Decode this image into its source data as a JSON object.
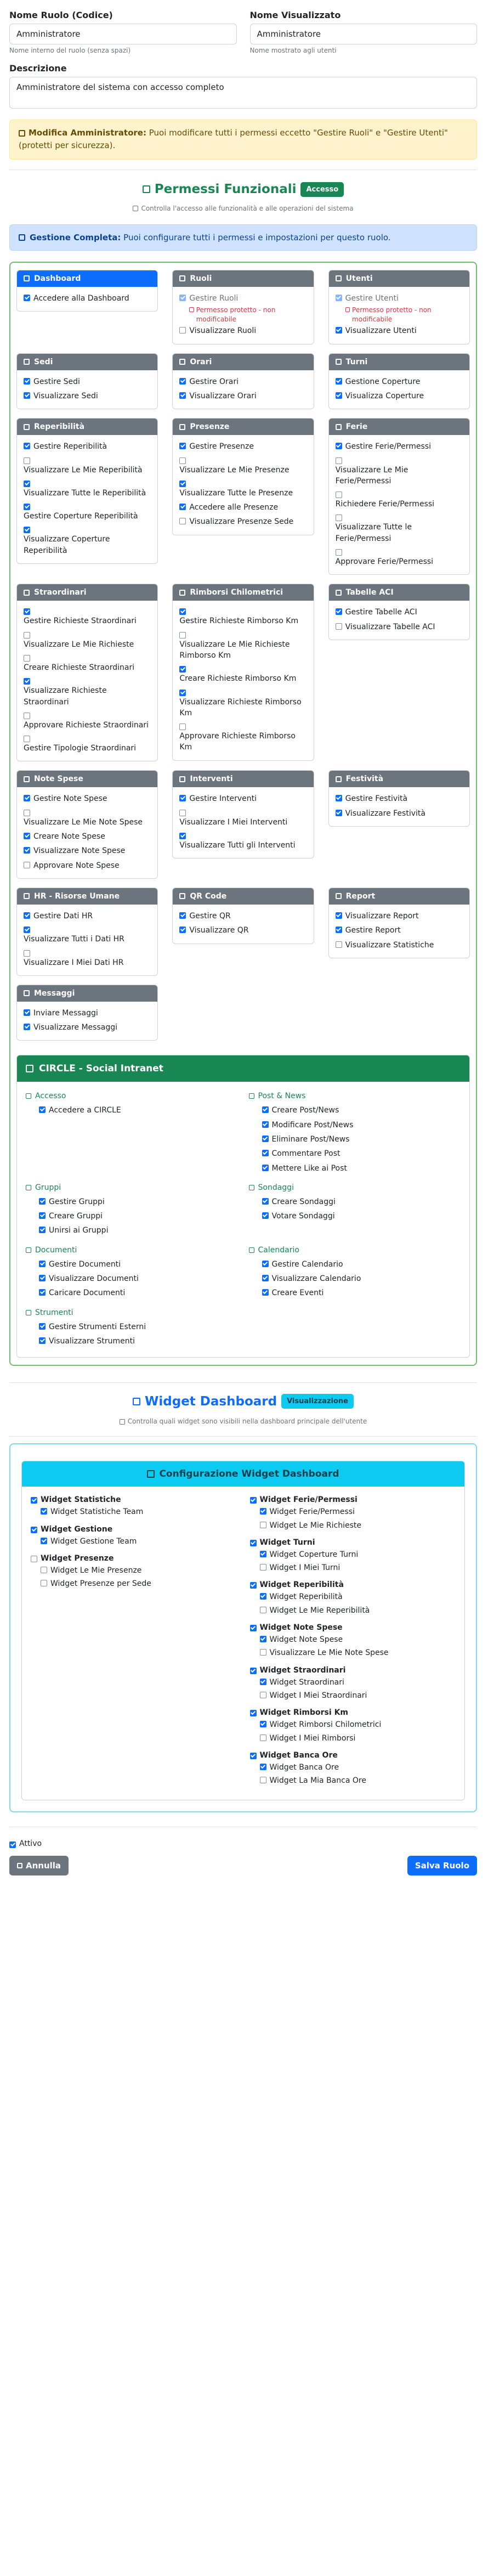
{
  "form": {
    "code_label": "Nome Ruolo (Codice)",
    "code_value": "Amministratore",
    "code_hint": "Nome interno del ruolo (senza spazi)",
    "display_label": "Nome Visualizzato",
    "display_value": "Amministratore",
    "display_hint": "Nome mostrato agli utenti",
    "desc_label": "Descrizione",
    "desc_value": "Amministratore del sistema con accesso completo"
  },
  "admin_alert": {
    "title": "Modifica Amministratore:",
    "text": " Puoi modificare tutti i permessi eccetto \"Gestire Ruoli\" e \"Gestire Utenti\" (protetti per sicurezza)."
  },
  "functional": {
    "title": "Permessi Funzionali",
    "badge": "Accesso",
    "subtitle": "Controlla l'accesso alle funzionalità e alle operazioni del sistema",
    "info_title": "Gestione Completa:",
    "info_text": " Puoi configurare tutti i permessi e impostazioni per questo ruolo.",
    "protected_note": "Permesso protetto - non modificabile",
    "cards": [
      {
        "title": "Dashboard",
        "primary": true,
        "items": [
          {
            "label": "Accedere alla Dashboard",
            "on": true
          }
        ]
      },
      {
        "title": "Ruoli",
        "items": [
          {
            "label": "Gestire Ruoli",
            "on": true,
            "protected": true
          },
          {
            "label": "Visualizzare Ruoli",
            "on": false
          }
        ]
      },
      {
        "title": "Utenti",
        "items": [
          {
            "label": "Gestire Utenti",
            "on": true,
            "protected": true
          },
          {
            "label": "Visualizzare Utenti",
            "on": true
          }
        ]
      },
      {
        "title": "Sedi",
        "items": [
          {
            "label": "Gestire Sedi",
            "on": true
          },
          {
            "label": "Visualizzare Sedi",
            "on": true
          }
        ]
      },
      {
        "title": "Orari",
        "items": [
          {
            "label": "Gestire Orari",
            "on": true
          },
          {
            "label": "Visualizzare Orari",
            "on": true
          }
        ]
      },
      {
        "title": "Turni",
        "items": [
          {
            "label": "Gestione Coperture",
            "on": true
          },
          {
            "label": "Visualizza Coperture",
            "on": true
          }
        ]
      },
      {
        "title": "Reperibilità",
        "stack": true,
        "items": [
          {
            "label": "Gestire Reperibilità",
            "on": true,
            "inline": true
          },
          {
            "label": "Visualizzare Le Mie Reperibilità",
            "on": false
          },
          {
            "label": "Visualizzare Tutte le Reperibilità",
            "on": true
          },
          {
            "label": "Gestire Coperture Reperibilità",
            "on": true
          },
          {
            "label": "Visualizzare Coperture Reperibilità",
            "on": true
          }
        ]
      },
      {
        "title": "Presenze",
        "stack": true,
        "items": [
          {
            "label": "Gestire Presenze",
            "on": true,
            "inline": true
          },
          {
            "label": "Visualizzare Le Mie Presenze",
            "on": false
          },
          {
            "label": "Visualizzare Tutte le Presenze",
            "on": true
          },
          {
            "label": "Accedere alle Presenze",
            "on": true,
            "inline": true
          },
          {
            "label": "Visualizzare Presenze Sede",
            "on": false,
            "inline": true
          }
        ]
      },
      {
        "title": "Ferie",
        "stack": true,
        "items": [
          {
            "label": "Gestire Ferie/Permessi",
            "on": true,
            "inline": true
          },
          {
            "label": "Visualizzare Le Mie Ferie/Permessi",
            "on": false
          },
          {
            "label": "Richiedere Ferie/Permessi",
            "on": false
          },
          {
            "label": "Visualizzare Tutte le Ferie/Permessi",
            "on": false
          },
          {
            "label": "Approvare Ferie/Permessi",
            "on": false
          }
        ]
      },
      {
        "title": "Straordinari",
        "stack": true,
        "items": [
          {
            "label": "Gestire Richieste Straordinari",
            "on": true
          },
          {
            "label": "Visualizzare Le Mie Richieste",
            "on": false
          },
          {
            "label": "Creare Richieste Straordinari",
            "on": false
          },
          {
            "label": "Visualizzare Richieste Straordinari",
            "on": true
          },
          {
            "label": "Approvare Richieste Straordinari",
            "on": false
          },
          {
            "label": "Gestire Tipologie Straordinari",
            "on": false
          }
        ]
      },
      {
        "title": "Rimborsi Chilometrici",
        "stack": true,
        "items": [
          {
            "label": "Gestire Richieste Rimborso Km",
            "on": true
          },
          {
            "label": "Visualizzare Le Mie Richieste Rimborso Km",
            "on": false
          },
          {
            "label": "Creare Richieste Rimborso Km",
            "on": true
          },
          {
            "label": "Visualizzare Richieste Rimborso Km",
            "on": true
          },
          {
            "label": "Approvare Richieste Rimborso Km",
            "on": false
          }
        ]
      },
      {
        "title": "Tabelle ACI",
        "items": [
          {
            "label": "Gestire Tabelle ACI",
            "on": true
          },
          {
            "label": "Visualizzare Tabelle ACI",
            "on": false
          }
        ]
      },
      {
        "title": "Note Spese",
        "stack": true,
        "items": [
          {
            "label": "Gestire Note Spese",
            "on": true,
            "inline": true
          },
          {
            "label": "Visualizzare Le Mie Note Spese",
            "on": false
          },
          {
            "label": "Creare Note Spese",
            "on": true,
            "inline": true
          },
          {
            "label": "Visualizzare Note Spese",
            "on": true,
            "inline": true
          },
          {
            "label": "Approvare Note Spese",
            "on": false,
            "inline": true
          }
        ]
      },
      {
        "title": "Interventi",
        "stack": true,
        "items": [
          {
            "label": "Gestire Interventi",
            "on": true,
            "inline": true
          },
          {
            "label": "Visualizzare I Miei Interventi",
            "on": false
          },
          {
            "label": "Visualizzare Tutti gli Interventi",
            "on": true
          }
        ]
      },
      {
        "title": "Festività",
        "items": [
          {
            "label": "Gestire Festività",
            "on": true
          },
          {
            "label": "Visualizzare Festività",
            "on": true
          }
        ]
      },
      {
        "title": "HR - Risorse Umane",
        "stack": true,
        "items": [
          {
            "label": "Gestire Dati HR",
            "on": true,
            "inline": true
          },
          {
            "label": "Visualizzare Tutti i Dati HR",
            "on": true
          },
          {
            "label": "Visualizzare I Miei Dati HR",
            "on": false
          }
        ]
      },
      {
        "title": "QR Code",
        "items": [
          {
            "label": "Gestire QR",
            "on": true
          },
          {
            "label": "Visualizzare QR",
            "on": true
          }
        ]
      },
      {
        "title": "Report",
        "items": [
          {
            "label": "Visualizzare Report",
            "on": true
          },
          {
            "label": "Gestire Report",
            "on": true
          },
          {
            "label": "Visualizzare Statistiche",
            "on": false
          }
        ]
      },
      {
        "title": "Messaggi",
        "items": [
          {
            "label": "Inviare Messaggi",
            "on": true
          },
          {
            "label": "Visualizzare Messaggi",
            "on": true
          }
        ]
      }
    ]
  },
  "circle": {
    "title": "CIRCLE - Social Intranet",
    "groups": [
      {
        "title": "Accesso",
        "items": [
          {
            "label": "Accedere a CIRCLE",
            "on": true
          }
        ]
      },
      {
        "title": "Post & News",
        "items": [
          {
            "label": "Creare Post/News",
            "on": true
          },
          {
            "label": "Modificare Post/News",
            "on": true
          },
          {
            "label": "Eliminare Post/News",
            "on": true
          },
          {
            "label": "Commentare Post",
            "on": true
          },
          {
            "label": "Mettere Like ai Post",
            "on": true
          }
        ]
      },
      {
        "title": "Gruppi",
        "items": [
          {
            "label": "Gestire Gruppi",
            "on": true
          },
          {
            "label": "Creare Gruppi",
            "on": true
          },
          {
            "label": "Unirsi ai Gruppi",
            "on": true
          }
        ]
      },
      {
        "title": "Sondaggi",
        "items": [
          {
            "label": "Creare Sondaggi",
            "on": true
          },
          {
            "label": "Votare Sondaggi",
            "on": true
          }
        ]
      },
      {
        "title": "Documenti",
        "items": [
          {
            "label": "Gestire Documenti",
            "on": true
          },
          {
            "label": "Visualizzare Documenti",
            "on": true
          },
          {
            "label": "Caricare Documenti",
            "on": true
          }
        ]
      },
      {
        "title": "Calendario",
        "items": [
          {
            "label": "Gestire Calendario",
            "on": true
          },
          {
            "label": "Visualizzare Calendario",
            "on": true
          },
          {
            "label": "Creare Eventi",
            "on": true
          }
        ]
      },
      {
        "title": "Strumenti",
        "items": [
          {
            "label": "Gestire Strumenti Esterni",
            "on": true
          },
          {
            "label": "Visualizzare Strumenti",
            "on": true
          }
        ]
      }
    ]
  },
  "widgets": {
    "title": "Widget Dashboard",
    "badge": "Visualizzazione",
    "subtitle": "Controlla quali widget sono visibili nella dashboard principale dell'utente",
    "card_title": "Configurazione Widget Dashboard",
    "left": [
      {
        "label": "Widget Statistiche",
        "on": true,
        "subs": [
          {
            "label": "Widget Statistiche Team",
            "on": true
          }
        ]
      },
      {
        "label": "Widget Gestione",
        "on": true,
        "subs": [
          {
            "label": "Widget Gestione Team",
            "on": true
          }
        ]
      },
      {
        "label": "Widget Presenze",
        "on": false,
        "subs": [
          {
            "label": "Widget Le Mie Presenze",
            "on": false
          },
          {
            "label": "Widget Presenze per Sede",
            "on": false
          }
        ]
      }
    ],
    "right": [
      {
        "label": "Widget Ferie/Permessi",
        "on": true,
        "subs": [
          {
            "label": "Widget Ferie/Permessi",
            "on": true
          },
          {
            "label": "Widget Le Mie Richieste",
            "on": false
          }
        ]
      },
      {
        "label": "Widget Turni",
        "on": true,
        "subs": [
          {
            "label": "Widget Coperture Turni",
            "on": true
          },
          {
            "label": "Widget I Miei Turni",
            "on": false
          }
        ]
      },
      {
        "label": "Widget Reperibilità",
        "on": true,
        "subs": [
          {
            "label": "Widget Reperibilità",
            "on": true
          },
          {
            "label": "Widget Le Mie Reperibilità",
            "on": false
          }
        ]
      },
      {
        "label": "Widget Note Spese",
        "on": true,
        "subs": [
          {
            "label": "Widget Note Spese",
            "on": true
          },
          {
            "label": "Visualizzare Le Mie Note Spese",
            "on": false
          }
        ]
      },
      {
        "label": "Widget Straordinari",
        "on": true,
        "subs": [
          {
            "label": "Widget Straordinari",
            "on": true
          },
          {
            "label": "Widget I Miei Straordinari",
            "on": false
          }
        ]
      },
      {
        "label": "Widget Rimborsi Km",
        "on": true,
        "subs": [
          {
            "label": "Widget Rimborsi Chilometrici",
            "on": true
          },
          {
            "label": "Widget I Miei Rimborsi",
            "on": false
          }
        ]
      },
      {
        "label": "Widget Banca Ore",
        "on": true,
        "subs": [
          {
            "label": "Widget Banca Ore",
            "on": true
          },
          {
            "label": "Widget La Mia Banca Ore",
            "on": false
          }
        ]
      }
    ]
  },
  "footer": {
    "active_label": "Attivo",
    "active_on": true,
    "cancel_label": "Annulla",
    "save_label": "Salva Ruolo"
  },
  "colors": {
    "primary": "#0d6efd",
    "success": "#198754",
    "info": "#0dcaf0",
    "secondary": "#6c757d",
    "danger": "#dc3545"
  }
}
